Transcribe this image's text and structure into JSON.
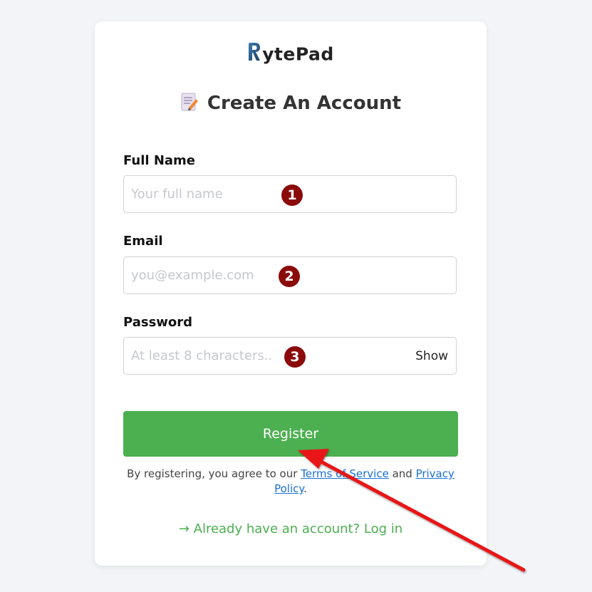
{
  "brand": {
    "name": "ytePad",
    "logo_letter": "R",
    "logo_colors": [
      "#2c5f8a",
      "#1f3f66"
    ]
  },
  "title": "Create An Account",
  "fields": {
    "full_name": {
      "label": "Full Name",
      "placeholder": "Your full name",
      "value": "",
      "badge": "1"
    },
    "email": {
      "label": "Email",
      "placeholder": "you@example.com",
      "value": "",
      "badge": "2"
    },
    "password": {
      "label": "Password",
      "placeholder": "At least 8 characters..",
      "value": "",
      "badge": "3",
      "toggle_label": "Show"
    }
  },
  "register_label": "Register",
  "terms": {
    "prefix": "By registering, you agree to our ",
    "tos_label": "Terms of Service",
    "and": " and ",
    "privacy_label": "Privacy Policy",
    "suffix": "."
  },
  "login_link": "→ Already have an account? Log in",
  "colors": {
    "accent": "#4caf50",
    "badge": "#8b0a0a",
    "link": "#1a6fd6",
    "annotation_arrow": "#e81414"
  }
}
